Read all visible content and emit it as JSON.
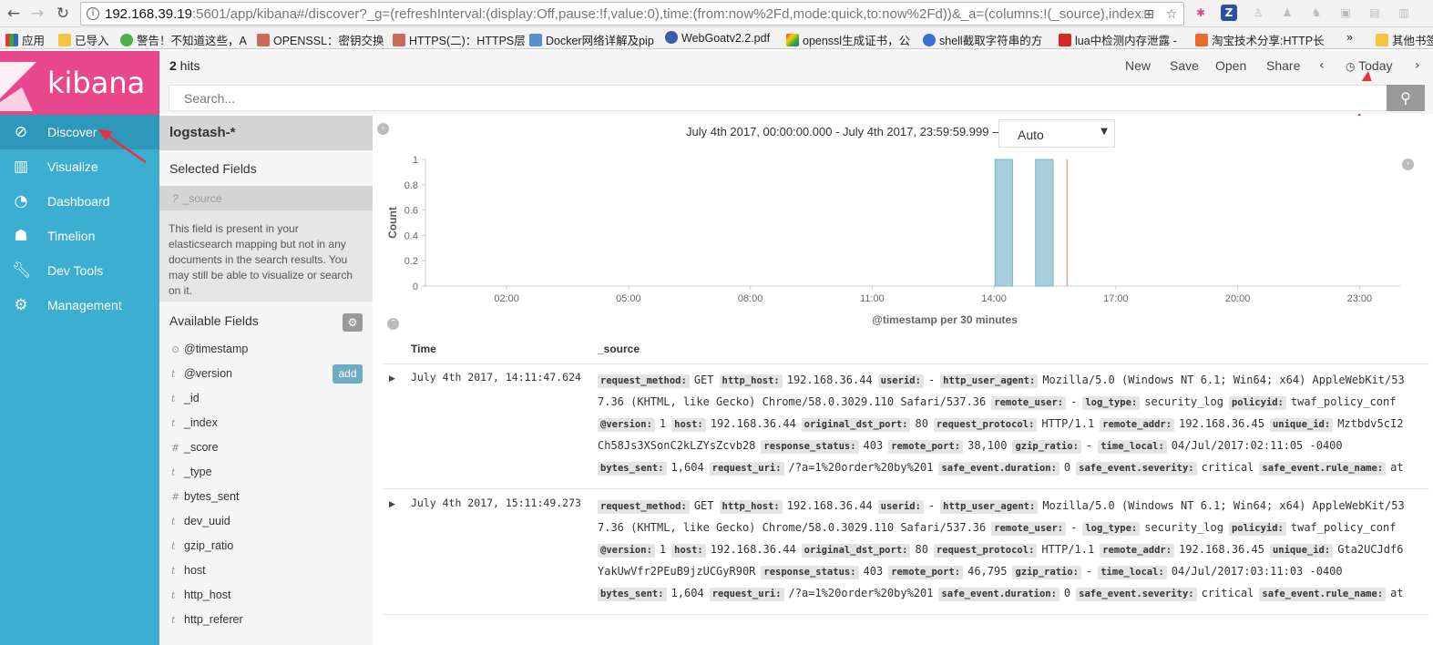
{
  "browser": {
    "url_host": "192.168.39.19",
    "url_rest": ":5601/app/kibana#/discover?_g=(refreshInterval:(display:Off,pause:!f,value:0),time:(from:now%2Fd,mode:quick,to:now%2Fd))&_a=(columns:!(_source),index:",
    "bookmarks": [
      "应用",
      "已导入",
      "警告！不知道这些，A",
      "OPENSSL：密钥交换",
      "HTTPS(二)：HTTPS层",
      "Docker网络详解及pip",
      "WebGoatv2.2.pdf",
      "openssl生成证书，公",
      "shell截取字符串的方",
      "lua中检测内存泄露 -",
      "淘宝技术分享:HTTP长",
      "»",
      "其他书签"
    ]
  },
  "app": {
    "logo": "kibana",
    "nav": [
      {
        "label": "Discover",
        "icon": "compass-icon"
      },
      {
        "label": "Visualize",
        "icon": "bar-chart-icon"
      },
      {
        "label": "Dashboard",
        "icon": "dashboard-icon"
      },
      {
        "label": "Timelion",
        "icon": "timelion-icon"
      },
      {
        "label": "Dev Tools",
        "icon": "wrench-icon"
      },
      {
        "label": "Management",
        "icon": "gear-icon"
      }
    ]
  },
  "topbar": {
    "hits_count": "2",
    "hits_label": " hits",
    "new": "New",
    "save": "Save",
    "open": "Open",
    "share": "Share",
    "time_label": "Today"
  },
  "search": {
    "placeholder": "Search..."
  },
  "fields_panel": {
    "index_pattern": "logstash-*",
    "selected_heading": "Selected Fields",
    "selected_field": "_source",
    "selected_field_type": "?",
    "note": "This field is present in your elasticsearch mapping but not in any documents in the search results. You may still be able to visualize or search on it.",
    "available_heading": "Available Fields",
    "add_label": "add",
    "fields": [
      {
        "type": "⊙",
        "name": "@timestamp"
      },
      {
        "type": "t",
        "name": "@version"
      },
      {
        "type": "t",
        "name": "_id"
      },
      {
        "type": "t",
        "name": "_index"
      },
      {
        "type": "#",
        "name": "_score"
      },
      {
        "type": "t",
        "name": "_type"
      },
      {
        "type": "#",
        "name": "bytes_sent"
      },
      {
        "type": "t",
        "name": "dev_uuid"
      },
      {
        "type": "t",
        "name": "gzip_ratio"
      },
      {
        "type": "t",
        "name": "host"
      },
      {
        "type": "t",
        "name": "http_host"
      },
      {
        "type": "t",
        "name": "http_referer"
      }
    ]
  },
  "histogram": {
    "time_range": "July 4th 2017, 00:00:00.000 - July 4th 2017, 23:59:59.999 —",
    "interval": "Auto",
    "x_axis_title": "@timestamp per 30 minutes"
  },
  "chart_data": {
    "type": "bar",
    "ylabel": "Count",
    "xlabel": "@timestamp per 30 minutes",
    "x_ticks": [
      "02:00",
      "05:00",
      "08:00",
      "11:00",
      "14:00",
      "17:00",
      "20:00",
      "23:00"
    ],
    "x_tick_hours": [
      2,
      5,
      8,
      11,
      14,
      17,
      20,
      23
    ],
    "xlim_hours": [
      0,
      24
    ],
    "y_ticks": [
      "0",
      "0.2",
      "0.4",
      "0.6",
      "0.8",
      "1"
    ],
    "ylim": [
      0,
      1
    ],
    "bars": [
      {
        "start_hour": 14.0,
        "value": 1
      },
      {
        "start_hour": 15.0,
        "value": 1
      }
    ],
    "now_marker_hour": 15.8
  },
  "table": {
    "col_time": "Time",
    "col_source": "_source",
    "docs": [
      {
        "time": "July 4th 2017, 14:11:47.624",
        "lines": [
          [
            [
              "request_method:",
              "GET"
            ],
            [
              "http_host:",
              "192.168.36.44"
            ],
            [
              "userid:",
              "-"
            ],
            [
              "http_user_agent:",
              "Mozilla/5.0 (Windows NT 6.1; Win64; x64) AppleWebKit/53"
            ]
          ],
          [
            [
              "",
              "7.36 (KHTML, like Gecko) Chrome/58.0.3029.110 Safari/537.36"
            ],
            [
              "remote_user:",
              "-"
            ],
            [
              "log_type:",
              "security_log"
            ],
            [
              "policyid:",
              "twaf_policy_conf"
            ]
          ],
          [
            [
              "@version:",
              "1"
            ],
            [
              "host:",
              "192.168.36.44"
            ],
            [
              "original_dst_port:",
              "80"
            ],
            [
              "request_protocol:",
              "HTTP/1.1"
            ],
            [
              "remote_addr:",
              "192.168.36.45"
            ],
            [
              "unique_id:",
              "Mztbdv5cI2"
            ]
          ],
          [
            [
              "",
              "Ch58Js3XSonC2kLZYsZcvb28"
            ],
            [
              "response_status:",
              "403"
            ],
            [
              "remote_port:",
              "38,100"
            ],
            [
              "gzip_ratio:",
              "-"
            ],
            [
              "time_local:",
              "04/Jul/2017:02:11:05 -0400"
            ]
          ],
          [
            [
              "bytes_sent:",
              "1,604"
            ],
            [
              "request_uri:",
              "/?a=1%20order%20by%201"
            ],
            [
              "safe_event.duration:",
              "0"
            ],
            [
              "safe_event.severity:",
              "critical"
            ],
            [
              "safe_event.rule_name:",
              "at"
            ]
          ]
        ]
      },
      {
        "time": "July 4th 2017, 15:11:49.273",
        "lines": [
          [
            [
              "request_method:",
              "GET"
            ],
            [
              "http_host:",
              "192.168.36.44"
            ],
            [
              "userid:",
              "-"
            ],
            [
              "http_user_agent:",
              "Mozilla/5.0 (Windows NT 6.1; Win64; x64) AppleWebKit/53"
            ]
          ],
          [
            [
              "",
              "7.36 (KHTML, like Gecko) Chrome/58.0.3029.110 Safari/537.36"
            ],
            [
              "remote_user:",
              "-"
            ],
            [
              "log_type:",
              "security_log"
            ],
            [
              "policyid:",
              "twaf_policy_conf"
            ]
          ],
          [
            [
              "@version:",
              "1"
            ],
            [
              "host:",
              "192.168.36.44"
            ],
            [
              "original_dst_port:",
              "80"
            ],
            [
              "request_protocol:",
              "HTTP/1.1"
            ],
            [
              "remote_addr:",
              "192.168.36.45"
            ],
            [
              "unique_id:",
              "Gta2UCJdf6"
            ]
          ],
          [
            [
              "",
              "YakUwVfr2PEuB9jzUCGyR90R"
            ],
            [
              "response_status:",
              "403"
            ],
            [
              "remote_port:",
              "46,795"
            ],
            [
              "gzip_ratio:",
              "-"
            ],
            [
              "time_local:",
              "04/Jul/2017:03:11:03 -0400"
            ]
          ],
          [
            [
              "bytes_sent:",
              "1,604"
            ],
            [
              "request_uri:",
              "/?a=1%20order%20by%201"
            ],
            [
              "safe_event.duration:",
              "0"
            ],
            [
              "safe_event.severity:",
              "critical"
            ],
            [
              "safe_event.rule_name:",
              "at"
            ]
          ]
        ]
      }
    ]
  },
  "colors": {
    "sidebar": "#3caed2",
    "sidebar_active": "#2e98ba",
    "logo_bg": "#e8488b",
    "bar_fill": "#a7cedb",
    "now_marker": "#e8a0a0",
    "annotation_arrow": "#e8323c"
  }
}
